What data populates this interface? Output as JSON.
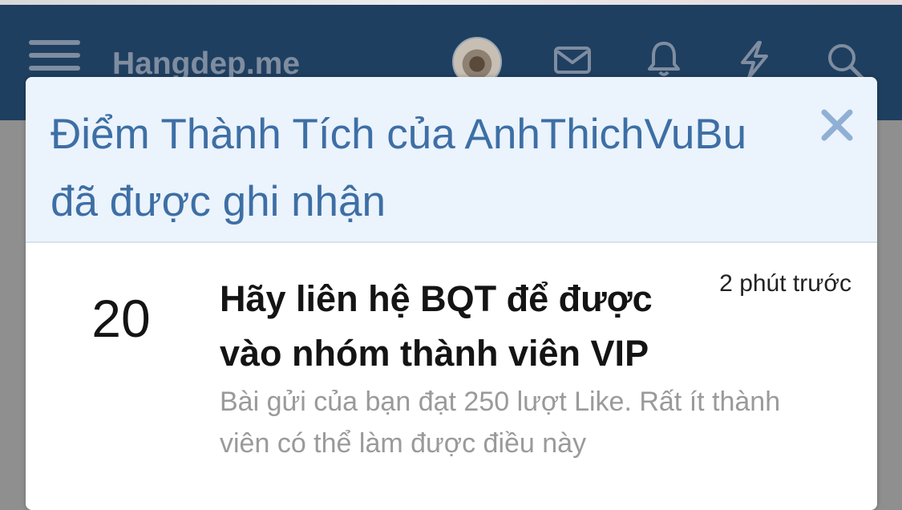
{
  "navbar": {
    "site_name": "Hangdep.me",
    "icons": [
      "hamburger-menu-icon",
      "avatar",
      "envelope-icon",
      "bell-icon",
      "lightning-icon",
      "search-icon"
    ]
  },
  "popup": {
    "title": "Điểm Thành Tích của AnhThichVuBu đã được ghi nhận",
    "close_icon": "close-icon",
    "trophy": {
      "points": "20",
      "title": "Hãy liên hệ BQT để được vào nhóm thành viên VIP",
      "time": "2 phút trước",
      "description": "Bài gửi của bạn đạt 250 lượt Like. Rất ít thành viên có thể làm được điều này"
    }
  },
  "colors": {
    "navbar": "#1f3f60",
    "header_bg": "#ebf3fc",
    "title_blue": "#3d6fa5",
    "close_blue": "#8fb0d4",
    "description_gray": "#9a9a9a"
  }
}
